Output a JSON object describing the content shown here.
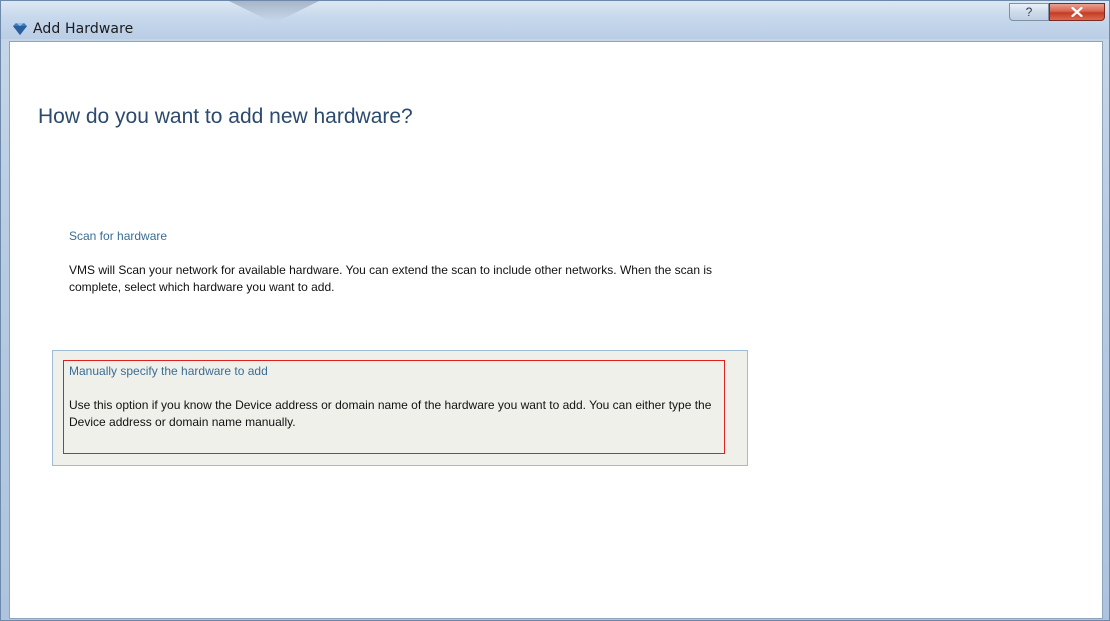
{
  "window": {
    "title": "Add Hardware",
    "help_label": "?",
    "close_label": "X",
    "icon": "app-diamond-icon",
    "accent_color": "#2c4a6e",
    "highlight_color": "#e02020"
  },
  "page": {
    "heading": "How do you want to add new hardware?"
  },
  "options": [
    {
      "title": "Scan for hardware",
      "description": "VMS will Scan your network for available hardware. You can extend the scan to include other networks. When the scan is complete, select which hardware you want to add.",
      "selected": false
    },
    {
      "title": "Manually specify the hardware to add",
      "description": "Use this option if you know the Device address or domain name of the hardware you want to add. You can either type the Device address or domain name manually.",
      "selected": true
    }
  ]
}
